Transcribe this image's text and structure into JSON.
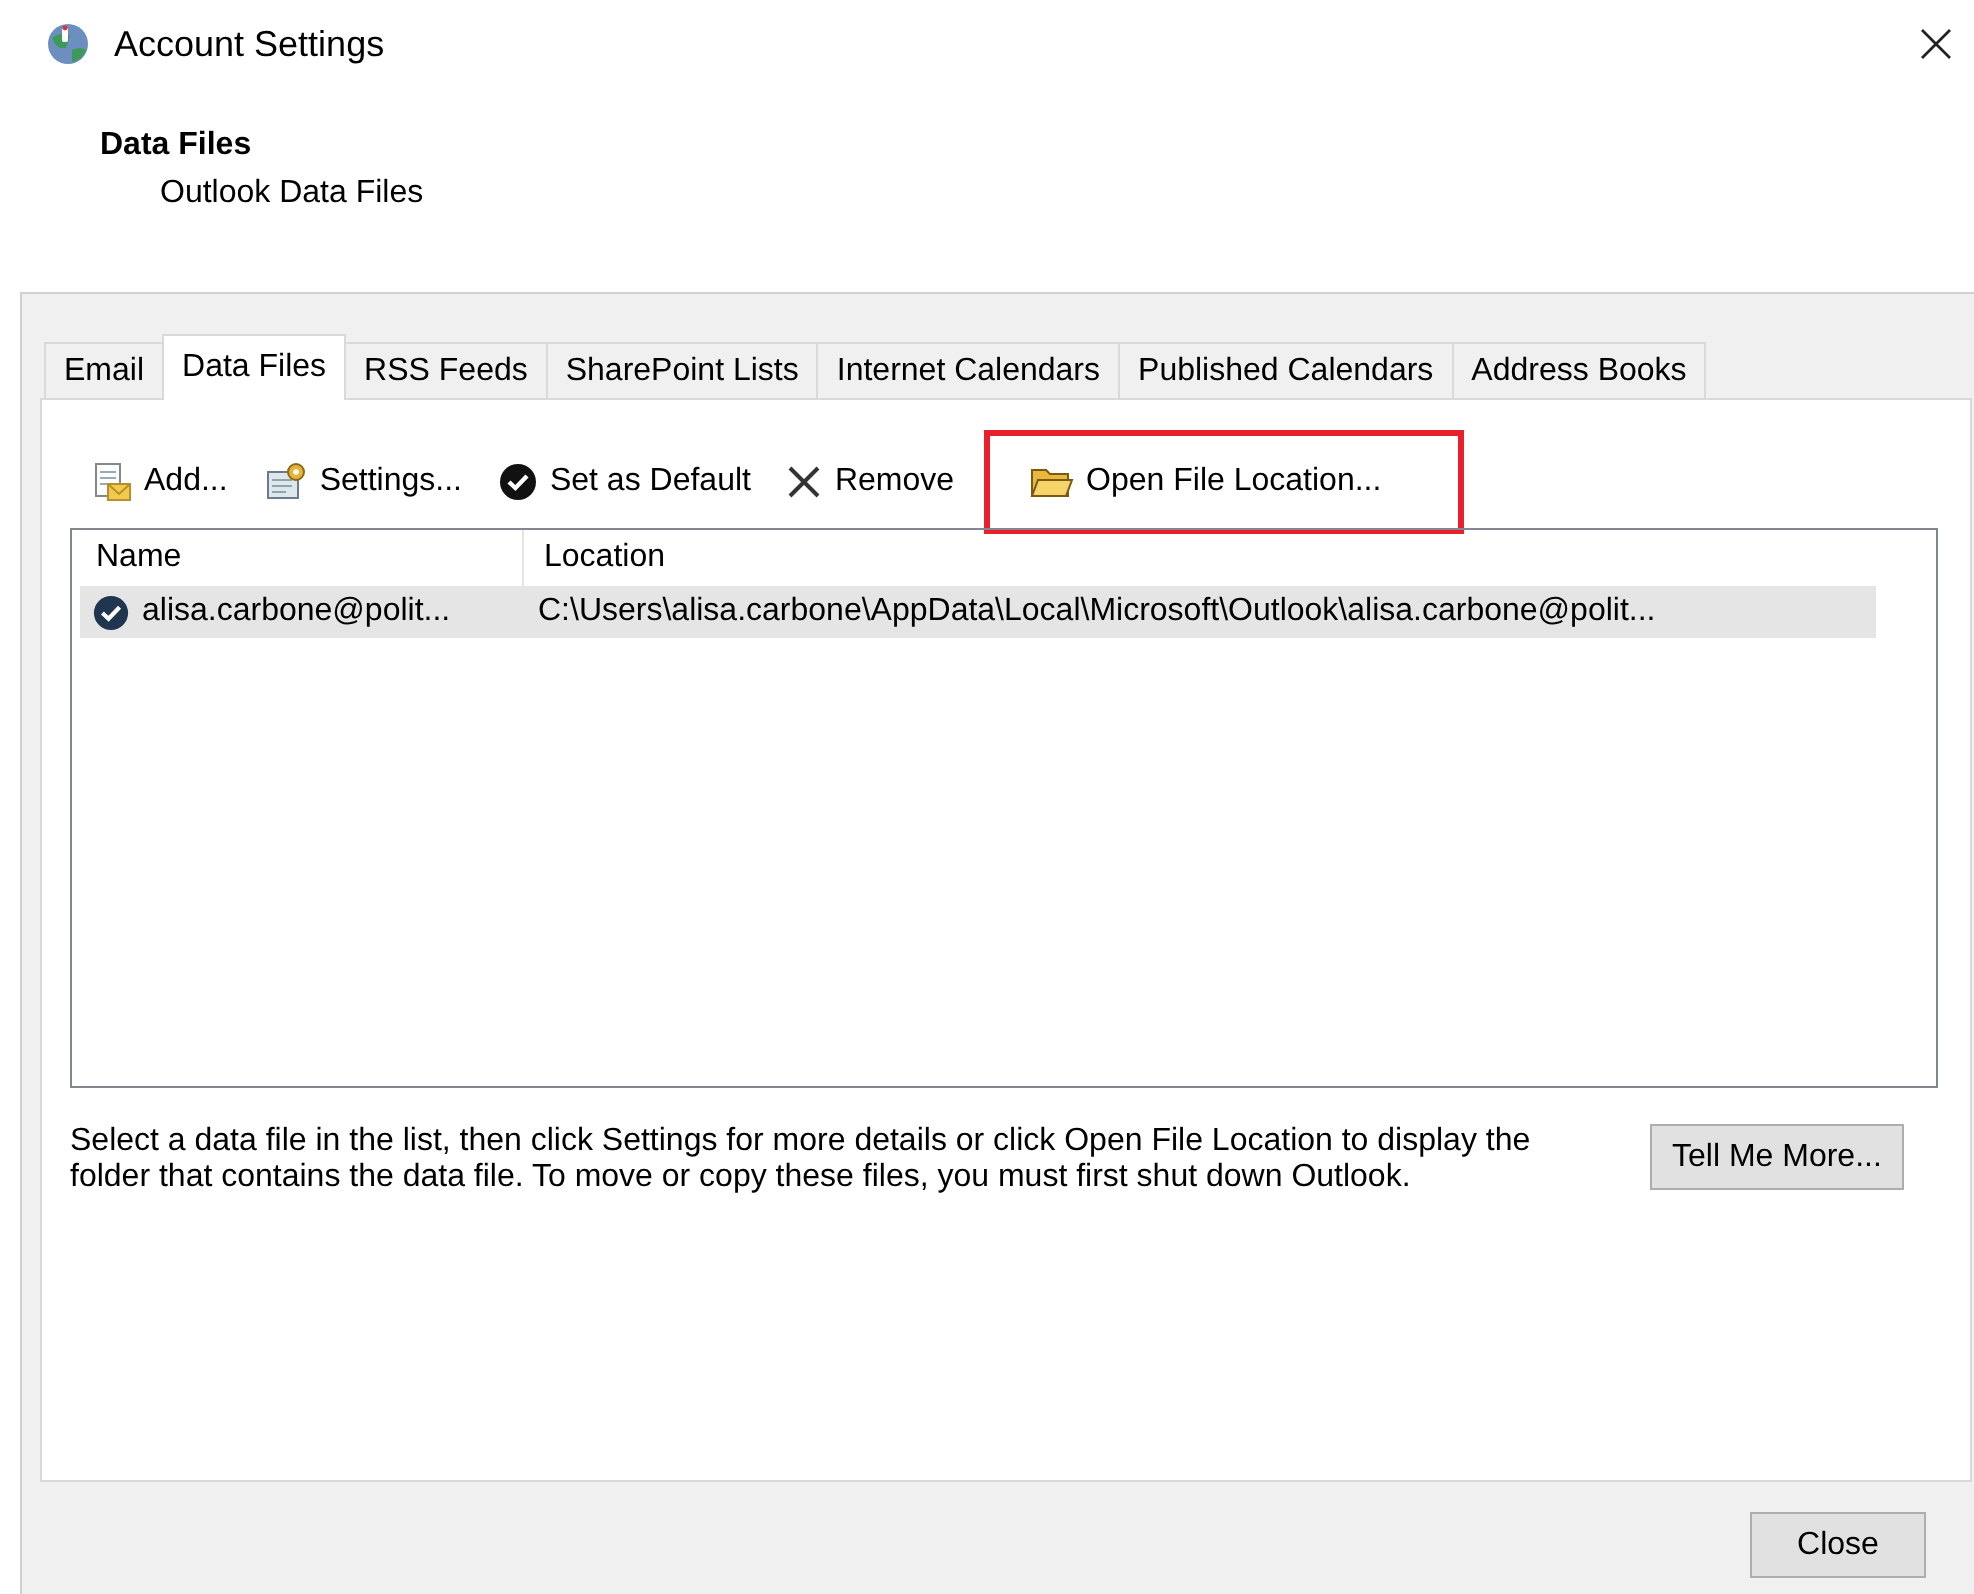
{
  "window": {
    "title": "Account Settings"
  },
  "header": {
    "title": "Data Files",
    "subtitle": "Outlook Data Files"
  },
  "tabs": [
    {
      "label": "Email",
      "selected": false
    },
    {
      "label": "Data Files",
      "selected": true
    },
    {
      "label": "RSS Feeds",
      "selected": false
    },
    {
      "label": "SharePoint Lists",
      "selected": false
    },
    {
      "label": "Internet Calendars",
      "selected": false
    },
    {
      "label": "Published Calendars",
      "selected": false
    },
    {
      "label": "Address Books",
      "selected": false
    }
  ],
  "toolbar": [
    {
      "kind": "add",
      "label": "Add...",
      "highlighted": false
    },
    {
      "kind": "settings",
      "label": "Settings...",
      "highlighted": false
    },
    {
      "kind": "default",
      "label": "Set as Default",
      "highlighted": false
    },
    {
      "kind": "remove",
      "label": "Remove",
      "highlighted": false
    },
    {
      "kind": "open",
      "label": "Open File Location...",
      "highlighted": true
    }
  ],
  "table": {
    "columns": [
      "Name",
      "Location"
    ],
    "rows": [
      {
        "name": "alisa.carbone@polit...",
        "location": "C:\\Users\\alisa.carbone\\AppData\\Local\\Microsoft\\Outlook\\alisa.carbone@polit...",
        "default": true,
        "selected": true
      }
    ]
  },
  "help_text": "Select a data file in the list, then click Settings for more details or click Open File Location to display the folder that contains the data file. To move or copy these files, you must first shut down Outlook.",
  "buttons": {
    "more": "Tell Me More...",
    "close": "Close"
  }
}
